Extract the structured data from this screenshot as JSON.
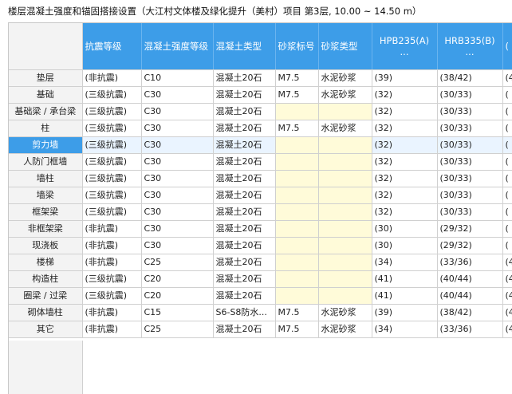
{
  "title": "楼层混凝土强度和锚固搭接设置（大江村文体楼及绿化提升（美村）项目  第3层, 10.00 ~ 14.50 m）",
  "columns": [
    {
      "label": "抗震等级"
    },
    {
      "label": "混凝土强度等级"
    },
    {
      "label": "混凝土类型"
    },
    {
      "label": "砂浆标号"
    },
    {
      "label": "砂浆类型"
    },
    {
      "label": "HPB235(A)",
      "sub": "..."
    },
    {
      "label": "HRB335(B)",
      "sub": "..."
    },
    {
      "label": "(",
      "sub": ""
    }
  ],
  "rows": [
    {
      "name": "垫层",
      "cells": [
        "(非抗震)",
        "C10",
        "混凝土20石",
        "M7.5",
        "水泥砂浆",
        "(39)",
        "(38/42)",
        "(4"
      ]
    },
    {
      "name": "基础",
      "cells": [
        "(三级抗震)",
        "C30",
        "混凝土20石",
        "M7.5",
        "水泥砂浆",
        "(32)",
        "(30/33)",
        "("
      ]
    },
    {
      "name": "基础梁 / 承台梁",
      "cells": [
        "(三级抗震)",
        "C30",
        "混凝土20石",
        "",
        "",
        "(32)",
        "(30/33)",
        "("
      ]
    },
    {
      "name": "柱",
      "cells": [
        "(三级抗震)",
        "C30",
        "混凝土20石",
        "M7.5",
        "水泥砂浆",
        "(32)",
        "(30/33)",
        "("
      ]
    },
    {
      "name": "剪力墙",
      "cells": [
        "(三级抗震)",
        "C30",
        "混凝土20石",
        "",
        "",
        "(32)",
        "(30/33)",
        "("
      ]
    },
    {
      "name": "人防门框墙",
      "cells": [
        "(三级抗震)",
        "C30",
        "混凝土20石",
        "",
        "",
        "(32)",
        "(30/33)",
        "("
      ]
    },
    {
      "name": "墙柱",
      "cells": [
        "(三级抗震)",
        "C30",
        "混凝土20石",
        "",
        "",
        "(32)",
        "(30/33)",
        "("
      ]
    },
    {
      "name": "墙梁",
      "cells": [
        "(三级抗震)",
        "C30",
        "混凝土20石",
        "",
        "",
        "(32)",
        "(30/33)",
        "("
      ]
    },
    {
      "name": "框架梁",
      "cells": [
        "(三级抗震)",
        "C30",
        "混凝土20石",
        "",
        "",
        "(32)",
        "(30/33)",
        "("
      ]
    },
    {
      "name": "非框架梁",
      "cells": [
        "(非抗震)",
        "C30",
        "混凝土20石",
        "",
        "",
        "(30)",
        "(29/32)",
        "("
      ]
    },
    {
      "name": "现浇板",
      "cells": [
        "(非抗震)",
        "C30",
        "混凝土20石",
        "",
        "",
        "(30)",
        "(29/32)",
        "("
      ]
    },
    {
      "name": "楼梯",
      "cells": [
        "(非抗震)",
        "C25",
        "混凝土20石",
        "",
        "",
        "(34)",
        "(33/36)",
        "(4"
      ]
    },
    {
      "name": "构造柱",
      "cells": [
        "(三级抗震)",
        "C20",
        "混凝土20石",
        "",
        "",
        "(41)",
        "(40/44)",
        "(4"
      ]
    },
    {
      "name": "圈梁 / 过梁",
      "cells": [
        "(三级抗震)",
        "C20",
        "混凝土20石",
        "",
        "",
        "(41)",
        "(40/44)",
        "(4"
      ]
    },
    {
      "name": "砌体墙柱",
      "cells": [
        "(非抗震)",
        "C15",
        "S6-S8防水...",
        "M7.5",
        "水泥砂浆",
        "(39)",
        "(38/42)",
        "(4"
      ]
    },
    {
      "name": "其它",
      "cells": [
        "(非抗震)",
        "C25",
        "混凝土20石",
        "M7.5",
        "水泥砂浆",
        "(34)",
        "(33/36)",
        "(4"
      ]
    }
  ],
  "selected_row": 4
}
